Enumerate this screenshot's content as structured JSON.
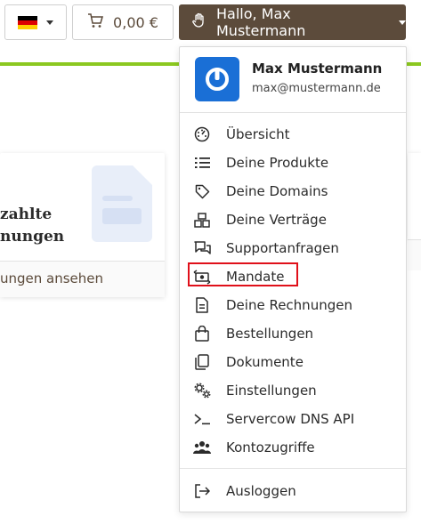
{
  "topbar": {
    "language": {
      "flag_colors": [
        "#000000",
        "#dd0000",
        "#ffce00"
      ]
    },
    "cart": {
      "amount": "0,00 €"
    },
    "user": {
      "greeting": "Hallo, Max Mustermann"
    }
  },
  "colors": {
    "accent_green": "#8bc820",
    "user_button_bg": "#5c4b3b",
    "avatar_bg": "#1a6fd6",
    "highlight_border": "#e0101a"
  },
  "background_card": {
    "title": "zahlte\nnungen",
    "footer_text": "ungen ansehen"
  },
  "dropdown": {
    "profile": {
      "name": "Max Mustermann",
      "email": "max@mustermann.de"
    },
    "items": [
      {
        "label": "Übersicht",
        "icon": "dashboard-icon"
      },
      {
        "label": "Deine Produkte",
        "icon": "list-icon"
      },
      {
        "label": "Deine Domains",
        "icon": "tag-icon"
      },
      {
        "label": "Deine Verträge",
        "icon": "contract-icon"
      },
      {
        "label": "Supportanfragen",
        "icon": "chat-icon"
      },
      {
        "label": "Mandate",
        "icon": "money-exchange-icon"
      },
      {
        "label": "Deine Rechnungen",
        "icon": "invoice-icon"
      },
      {
        "label": "Bestellungen",
        "icon": "shopping-bag-icon"
      },
      {
        "label": "Dokumente",
        "icon": "documents-icon"
      },
      {
        "label": "Einstellungen",
        "icon": "gears-icon"
      },
      {
        "label": "Servercow DNS API",
        "icon": "terminal-icon"
      },
      {
        "label": "Kontozugriffe",
        "icon": "users-icon"
      }
    ],
    "logout": {
      "label": "Ausloggen",
      "icon": "logout-icon"
    }
  }
}
